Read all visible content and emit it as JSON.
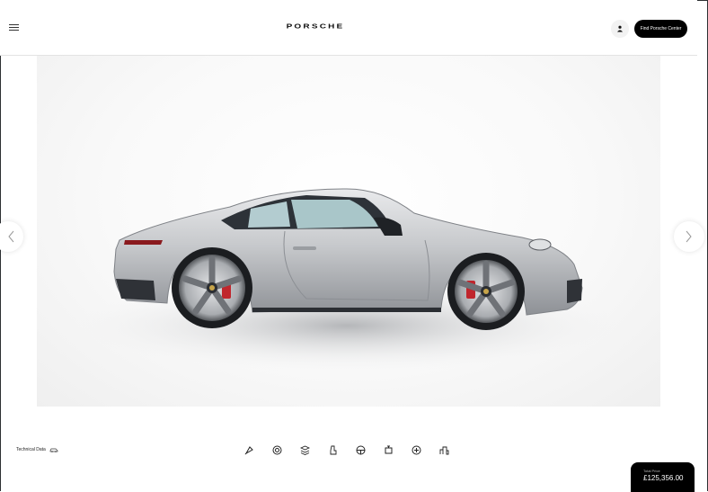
{
  "header": {
    "brand": "PORSCHE",
    "cta_label": "Find Porsche Center"
  },
  "viewer": {
    "alt": "Porsche 911 side view"
  },
  "footer": {
    "tech_label": "Technical Data",
    "price_label": "Total Price",
    "price_value": "£125,356.00",
    "config_icons": [
      "exterior-color-icon",
      "wheels-icon",
      "interior-icon",
      "seats-icon",
      "steering-wheel-icon",
      "engine-icon",
      "options-icon",
      "packages-icon"
    ]
  },
  "colors": {
    "accent": "#000000",
    "car_body": "#c9cbce",
    "caliper": "#c0262d"
  }
}
